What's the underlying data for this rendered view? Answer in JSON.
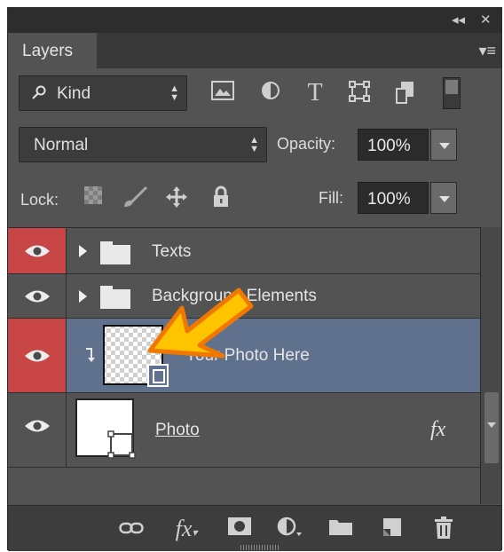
{
  "panel": {
    "tab_label": "Layers",
    "collapse_glyph": "◂◂",
    "close_glyph": "✕",
    "menu_glyph": "▾≡"
  },
  "filter": {
    "kind_label": "Kind",
    "icons": [
      "image-filter-icon",
      "adjustment-filter-icon",
      "type-filter-icon",
      "shape-filter-icon",
      "smart-object-filter-icon"
    ]
  },
  "blend": {
    "mode": "Normal",
    "opacity_label": "Opacity:",
    "opacity_value": "100%"
  },
  "lock": {
    "label": "Lock:",
    "fill_label": "Fill:",
    "fill_value": "100%"
  },
  "layers": [
    {
      "name": "Texts",
      "type": "group",
      "eye_color": "#c84646"
    },
    {
      "name": "Background Elements",
      "type": "group",
      "eye_color": "#535353"
    },
    {
      "name": "Your Photo Here",
      "type": "smart-object",
      "selected": true,
      "clipped": true,
      "eye_color": "#c84646"
    },
    {
      "name": "Photo",
      "type": "shape",
      "fx": "fx",
      "eye_color": "#535353"
    }
  ],
  "bottom_icons": [
    "link-layers-icon",
    "layer-style-icon",
    "layer-mask-icon",
    "adjustment-layer-icon",
    "new-group-icon",
    "new-layer-icon",
    "delete-layer-icon"
  ],
  "colors": {
    "panel_bg": "#535353",
    "selected_row": "#60718d",
    "eye_red": "#c84646",
    "arrow_yellow": "#ffc400",
    "arrow_orange": "#f07800"
  }
}
